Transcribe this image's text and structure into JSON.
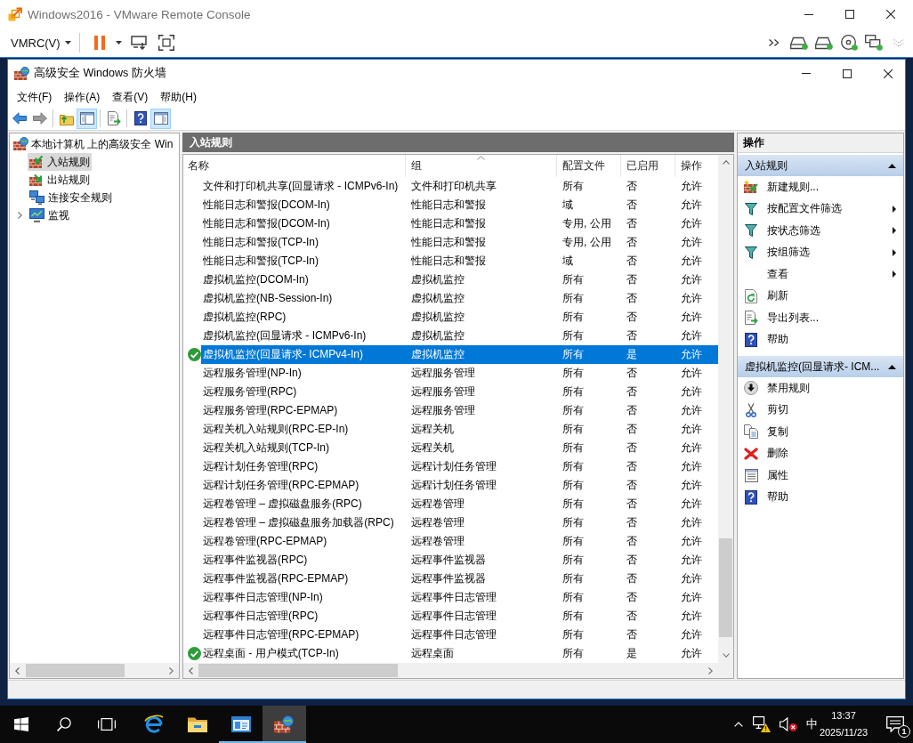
{
  "vmrc": {
    "title": "Windows2016 - VMware Remote Console",
    "menu_label": "VMRC(V)"
  },
  "window": {
    "title": "高级安全 Windows 防火墙",
    "menu": [
      "文件(F)",
      "操作(A)",
      "查看(V)",
      "帮助(H)"
    ],
    "toolbar": [
      {
        "disabled": false,
        "pressed": false
      },
      {
        "disabled": true,
        "pressed": false
      },
      {
        "disabled": false,
        "pressed": false
      },
      {
        "disabled": false,
        "pressed": true
      },
      {
        "disabled": false,
        "pressed": false
      },
      {
        "disabled": false,
        "pressed": false
      },
      {
        "disabled": false,
        "pressed": true
      }
    ]
  },
  "tree": {
    "label": "本地计算机 上的高级安全 Win",
    "children": [
      {
        "label": "入站规则",
        "selected": true
      },
      {
        "label": "出站规则",
        "selected": false
      },
      {
        "label": "连接安全规则",
        "selected": false
      },
      {
        "label": "监视",
        "selected": false,
        "expanded": false
      }
    ]
  },
  "rules": {
    "title": "入站规则",
    "columns": [
      {
        "label": "名称",
        "sorted": false
      },
      {
        "label": "组",
        "sorted": true
      },
      {
        "label": "配置文件",
        "sorted": false
      },
      {
        "label": "已启用",
        "sorted": false
      },
      {
        "label": "操作",
        "sorted": false
      }
    ],
    "rows": [
      {
        "name": "文件和打印机共享(回显请求 - ICMPv6-In)",
        "group": "文件和打印机共享",
        "profile": "所有",
        "enabled_text": "否",
        "action": "允许",
        "enabled": false,
        "selected": false
      },
      {
        "name": "性能日志和警报(DCOM-In)",
        "group": "性能日志和警报",
        "profile": "域",
        "enabled_text": "否",
        "action": "允许",
        "enabled": false,
        "selected": false
      },
      {
        "name": "性能日志和警报(DCOM-In)",
        "group": "性能日志和警报",
        "profile": "专用, 公用",
        "enabled_text": "否",
        "action": "允许",
        "enabled": false,
        "selected": false
      },
      {
        "name": "性能日志和警报(TCP-In)",
        "group": "性能日志和警报",
        "profile": "专用, 公用",
        "enabled_text": "否",
        "action": "允许",
        "enabled": false,
        "selected": false
      },
      {
        "name": "性能日志和警报(TCP-In)",
        "group": "性能日志和警报",
        "profile": "域",
        "enabled_text": "否",
        "action": "允许",
        "enabled": false,
        "selected": false
      },
      {
        "name": "虚拟机监控(DCOM-In)",
        "group": "虚拟机监控",
        "profile": "所有",
        "enabled_text": "否",
        "action": "允许",
        "enabled": false,
        "selected": false
      },
      {
        "name": "虚拟机监控(NB-Session-In)",
        "group": "虚拟机监控",
        "profile": "所有",
        "enabled_text": "否",
        "action": "允许",
        "enabled": false,
        "selected": false
      },
      {
        "name": "虚拟机监控(RPC)",
        "group": "虚拟机监控",
        "profile": "所有",
        "enabled_text": "否",
        "action": "允许",
        "enabled": false,
        "selected": false
      },
      {
        "name": "虚拟机监控(回显请求 - ICMPv6-In)",
        "group": "虚拟机监控",
        "profile": "所有",
        "enabled_text": "否",
        "action": "允许",
        "enabled": false,
        "selected": false
      },
      {
        "name": "虚拟机监控(回显请求- ICMPv4-In)",
        "group": "虚拟机监控",
        "profile": "所有",
        "enabled_text": "是",
        "action": "允许",
        "enabled": true,
        "selected": true
      },
      {
        "name": "远程服务管理(NP-In)",
        "group": "远程服务管理",
        "profile": "所有",
        "enabled_text": "否",
        "action": "允许",
        "enabled": false,
        "selected": false
      },
      {
        "name": "远程服务管理(RPC)",
        "group": "远程服务管理",
        "profile": "所有",
        "enabled_text": "否",
        "action": "允许",
        "enabled": false,
        "selected": false
      },
      {
        "name": "远程服务管理(RPC-EPMAP)",
        "group": "远程服务管理",
        "profile": "所有",
        "enabled_text": "否",
        "action": "允许",
        "enabled": false,
        "selected": false
      },
      {
        "name": "远程关机入站规则(RPC-EP-In)",
        "group": "远程关机",
        "profile": "所有",
        "enabled_text": "否",
        "action": "允许",
        "enabled": false,
        "selected": false
      },
      {
        "name": "远程关机入站规则(TCP-In)",
        "group": "远程关机",
        "profile": "所有",
        "enabled_text": "否",
        "action": "允许",
        "enabled": false,
        "selected": false
      },
      {
        "name": "远程计划任务管理(RPC)",
        "group": "远程计划任务管理",
        "profile": "所有",
        "enabled_text": "否",
        "action": "允许",
        "enabled": false,
        "selected": false
      },
      {
        "name": "远程计划任务管理(RPC-EPMAP)",
        "group": "远程计划任务管理",
        "profile": "所有",
        "enabled_text": "否",
        "action": "允许",
        "enabled": false,
        "selected": false
      },
      {
        "name": "远程卷管理 – 虚拟磁盘服务(RPC)",
        "group": "远程卷管理",
        "profile": "所有",
        "enabled_text": "否",
        "action": "允许",
        "enabled": false,
        "selected": false
      },
      {
        "name": "远程卷管理 – 虚拟磁盘服务加载器(RPC)",
        "group": "远程卷管理",
        "profile": "所有",
        "enabled_text": "否",
        "action": "允许",
        "enabled": false,
        "selected": false
      },
      {
        "name": "远程卷管理(RPC-EPMAP)",
        "group": "远程卷管理",
        "profile": "所有",
        "enabled_text": "否",
        "action": "允许",
        "enabled": false,
        "selected": false
      },
      {
        "name": "远程事件监视器(RPC)",
        "group": "远程事件监视器",
        "profile": "所有",
        "enabled_text": "否",
        "action": "允许",
        "enabled": false,
        "selected": false
      },
      {
        "name": "远程事件监视器(RPC-EPMAP)",
        "group": "远程事件监视器",
        "profile": "所有",
        "enabled_text": "否",
        "action": "允许",
        "enabled": false,
        "selected": false
      },
      {
        "name": "远程事件日志管理(NP-In)",
        "group": "远程事件日志管理",
        "profile": "所有",
        "enabled_text": "否",
        "action": "允许",
        "enabled": false,
        "selected": false
      },
      {
        "name": "远程事件日志管理(RPC)",
        "group": "远程事件日志管理",
        "profile": "所有",
        "enabled_text": "否",
        "action": "允许",
        "enabled": false,
        "selected": false
      },
      {
        "name": "远程事件日志管理(RPC-EPMAP)",
        "group": "远程事件日志管理",
        "profile": "所有",
        "enabled_text": "否",
        "action": "允许",
        "enabled": false,
        "selected": false
      },
      {
        "name": "远程桌面 - 用户模式(TCP-In)",
        "group": "远程桌面",
        "profile": "所有",
        "enabled_text": "是",
        "action": "允许",
        "enabled": true,
        "selected": false
      }
    ]
  },
  "actions": {
    "title": "操作",
    "sections": [
      {
        "title": "入站规则",
        "expanded": true,
        "items": [
          {
            "label": "新建规则...",
            "submenu": false
          },
          {
            "label": "按配置文件筛选",
            "submenu": true
          },
          {
            "label": "按状态筛选",
            "submenu": true
          },
          {
            "label": "按组筛选",
            "submenu": true
          },
          {
            "label": "查看",
            "submenu": true
          },
          {
            "label": "刷新",
            "submenu": false
          },
          {
            "label": "导出列表...",
            "submenu": false
          },
          {
            "label": "帮助",
            "submenu": false
          }
        ]
      },
      {
        "title": "虚拟机监控(回显请求- ICM...",
        "expanded": true,
        "items": [
          {
            "label": "禁用规则",
            "submenu": false
          },
          {
            "label": "剪切",
            "submenu": false
          },
          {
            "label": "复制",
            "submenu": false
          },
          {
            "label": "删除",
            "submenu": false
          },
          {
            "label": "属性",
            "submenu": false
          },
          {
            "label": "帮助",
            "submenu": false
          }
        ]
      }
    ]
  },
  "taskbar": {
    "apps": [
      {
        "running": false,
        "selected": false
      },
      {
        "running": false,
        "selected": false
      },
      {
        "running": true,
        "selected": false
      },
      {
        "running": true,
        "selected": true
      }
    ],
    "input_method": "中",
    "time": "13:37",
    "date": "2025/11/23",
    "notifications": "1"
  }
}
